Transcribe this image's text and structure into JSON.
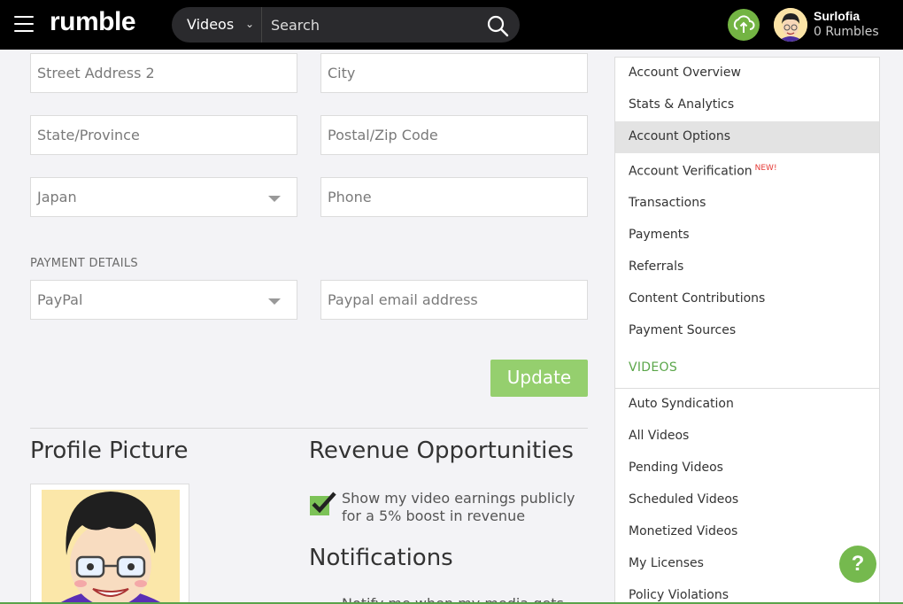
{
  "header": {
    "logo": "rumble",
    "search_category": "Videos",
    "search_placeholder": "Search",
    "user_name": "Surlofia",
    "user_rumbles": "0 Rumbles"
  },
  "address": {
    "street2_placeholder": "Street Address 2",
    "city_placeholder": "City",
    "state_placeholder": "State/Province",
    "zip_placeholder": "Postal/Zip Code",
    "country_value": "Japan",
    "phone_placeholder": "Phone"
  },
  "payment": {
    "section_label": "PAYMENT DETAILS",
    "method_value": "PayPal",
    "paypal_email_placeholder": "Paypal email address",
    "update_label": "Update"
  },
  "profile": {
    "title": "Profile Picture"
  },
  "revenue": {
    "title": "Revenue Opportunities",
    "checkbox_checked": true,
    "checkbox_label_line1": "Show my video earnings publicly",
    "checkbox_label_line2": "for a 5% boost in revenue"
  },
  "notifications": {
    "title": "Notifications",
    "first_item": "Notify me when my media gets"
  },
  "sidebar": {
    "items": [
      {
        "label": "Account Overview"
      },
      {
        "label": "Stats & Analytics"
      },
      {
        "label": "Account Options",
        "active": true
      },
      {
        "label": "Account Verification",
        "badge": "NEW!"
      },
      {
        "label": "Transactions"
      },
      {
        "label": "Payments"
      },
      {
        "label": "Referrals"
      },
      {
        "label": "Content Contributions"
      },
      {
        "label": "Payment Sources"
      }
    ],
    "videos_heading": "VIDEOS",
    "video_items": [
      {
        "label": "Auto Syndication"
      },
      {
        "label": "All Videos"
      },
      {
        "label": "Pending Videos"
      },
      {
        "label": "Scheduled Videos"
      },
      {
        "label": "Monetized Videos"
      },
      {
        "label": "My Licenses"
      },
      {
        "label": "Policy Violations"
      }
    ]
  },
  "help_label": "?",
  "colors": {
    "topbar": "#000000",
    "accent_green": "#75b94e",
    "update_button": "#95cf6e",
    "new_badge": "#e53935"
  }
}
